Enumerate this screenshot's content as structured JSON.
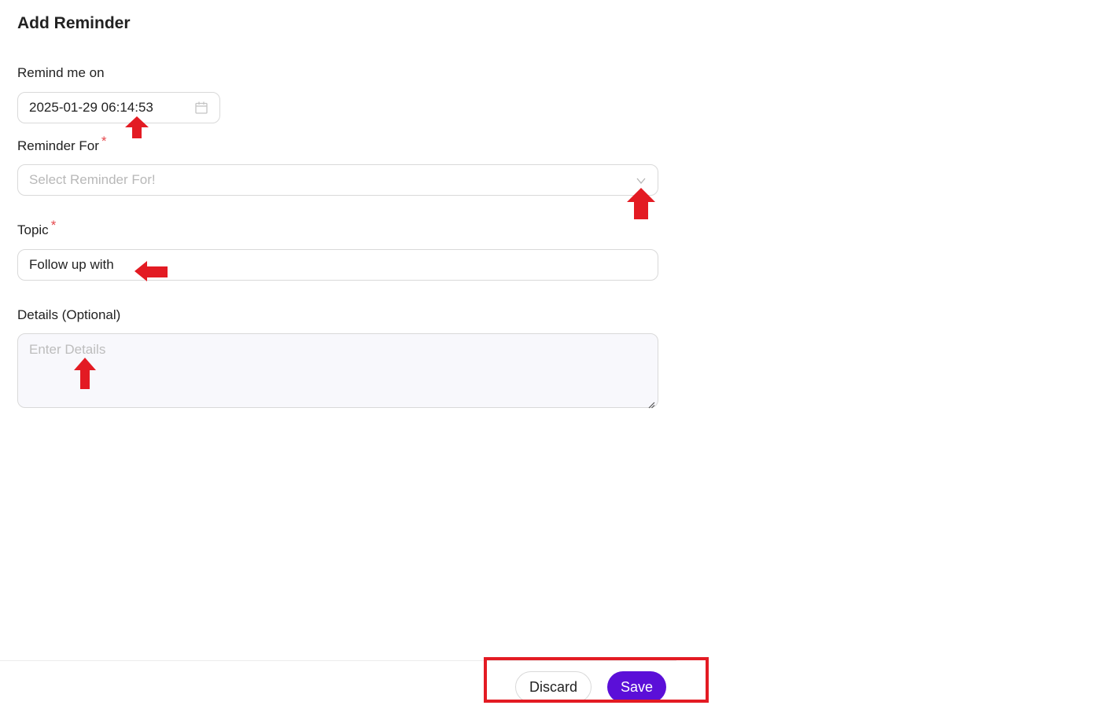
{
  "form": {
    "title": "Add Reminder",
    "remind_on": {
      "label": "Remind me on",
      "value": "2025-01-29 06:14:53",
      "icon": "calendar-icon"
    },
    "reminder_for": {
      "label": "Reminder For",
      "required_mark": "*",
      "placeholder": "Select Reminder For!",
      "icon": "chevron-down-icon"
    },
    "topic": {
      "label": "Topic",
      "required_mark": "*",
      "value": "Follow up with"
    },
    "details": {
      "label": "Details (Optional)",
      "placeholder": "Enter Details",
      "value": ""
    }
  },
  "footer": {
    "discard_label": "Discard",
    "save_label": "Save"
  },
  "colors": {
    "primary": "#5b0fd8",
    "required": "#e5484d",
    "annotation": "#e31b23"
  }
}
